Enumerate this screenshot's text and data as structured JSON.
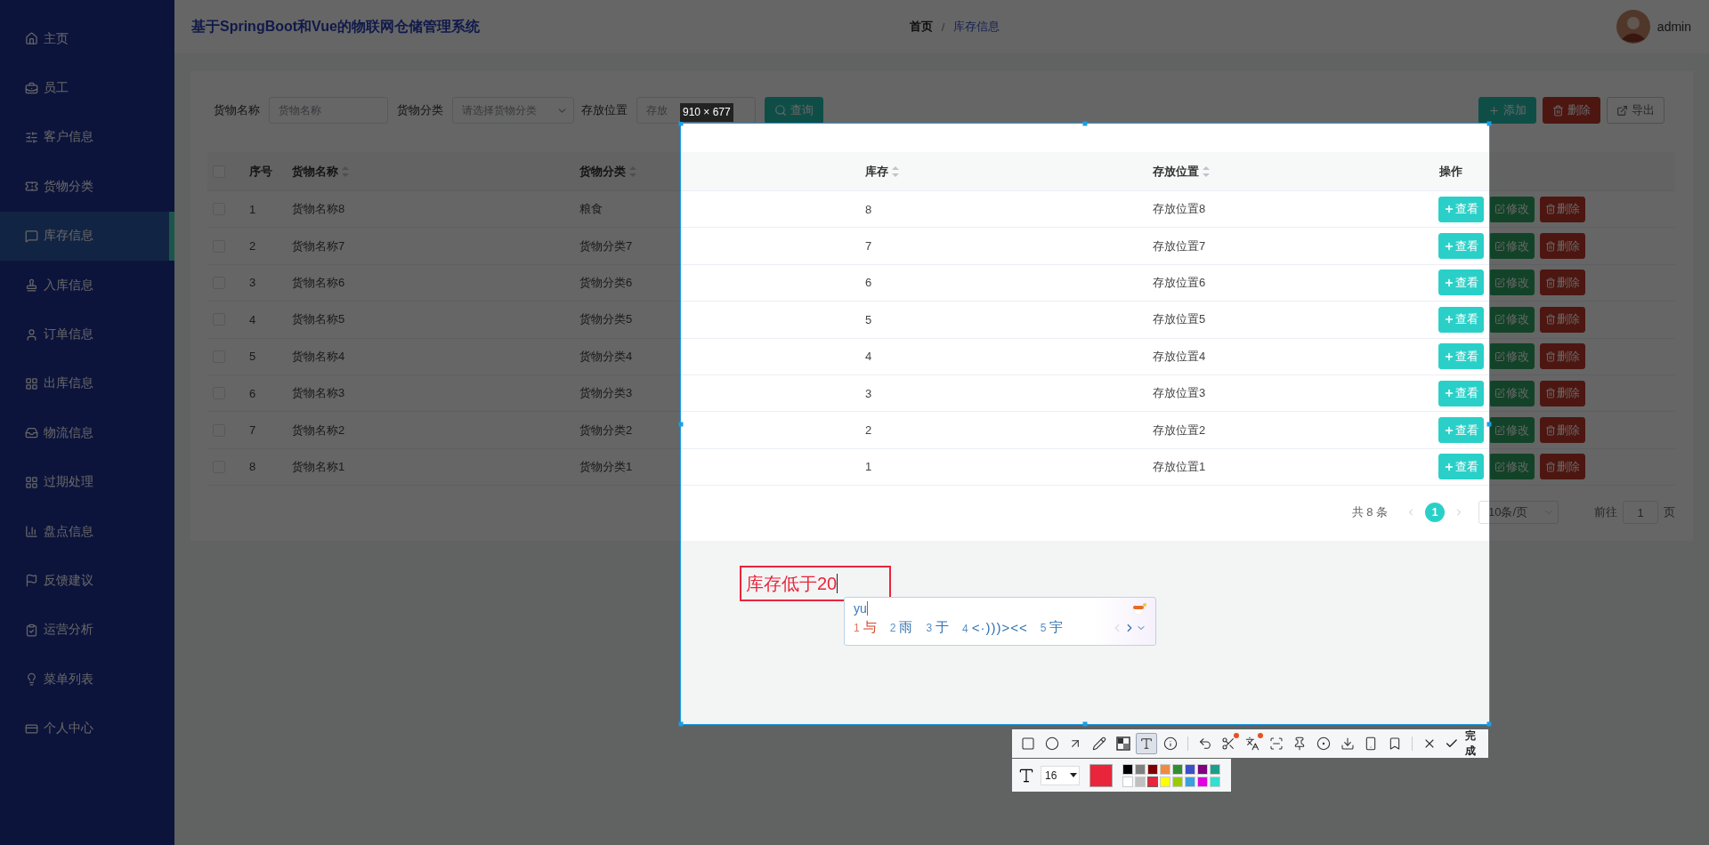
{
  "sidebar": {
    "items": [
      {
        "label": "主页",
        "selected": false
      },
      {
        "label": "员工",
        "selected": false
      },
      {
        "label": "客户信息",
        "selected": false
      },
      {
        "label": "货物分类",
        "selected": false
      },
      {
        "label": "库存信息",
        "selected": true
      },
      {
        "label": "入库信息",
        "selected": false
      },
      {
        "label": "订单信息",
        "selected": false
      },
      {
        "label": "出库信息",
        "selected": false
      },
      {
        "label": "物流信息",
        "selected": false
      },
      {
        "label": "过期处理",
        "selected": false
      },
      {
        "label": "盘点信息",
        "selected": false
      },
      {
        "label": "反馈建议",
        "selected": false
      },
      {
        "label": "运营分析",
        "selected": false
      },
      {
        "label": "菜单列表",
        "selected": false
      },
      {
        "label": "个人中心",
        "selected": false
      }
    ]
  },
  "header": {
    "title": "基于SpringBoot和Vue的物联网仓储管理系统",
    "breadcrumb": [
      {
        "label": "首页",
        "current": false
      },
      {
        "label": "库存信息",
        "current": true
      }
    ],
    "separator": "/",
    "user": "admin"
  },
  "filters": [
    {
      "label": "货物名称",
      "placeholder": "货物名称",
      "kind": "input"
    },
    {
      "label": "货物分类",
      "placeholder": "请选择货物分类",
      "kind": "select"
    },
    {
      "label": "存放位置",
      "placeholder": "存放",
      "kind": "input"
    }
  ],
  "search_button": "查询",
  "toolbar_buttons": [
    {
      "label": "添加",
      "kind": "add"
    },
    {
      "label": "删除",
      "kind": "delete"
    },
    {
      "label": "导出",
      "kind": "export"
    }
  ],
  "table": {
    "all_checked": false,
    "columns": [
      {
        "label": "序号",
        "sortable": false
      },
      {
        "label": "货物名称",
        "sortable": true
      },
      {
        "label": "货物分类",
        "sortable": true
      },
      {
        "label": "库存",
        "sortable": true
      },
      {
        "label": "存放位置",
        "sortable": true
      },
      {
        "label": "操作",
        "sortable": false
      }
    ],
    "rows": [
      {
        "checked": false,
        "cells": [
          "1",
          "货物名称8",
          "粮食",
          "8",
          "存放位置8"
        ],
        "actions": [
          {
            "label": "查看",
            "kind": "view"
          },
          {
            "label": "修改",
            "kind": "edit"
          },
          {
            "label": "删除",
            "kind": "delete"
          }
        ]
      },
      {
        "checked": false,
        "cells": [
          "2",
          "货物名称7",
          "货物分类7",
          "7",
          "存放位置7"
        ],
        "actions": [
          {
            "label": "查看",
            "kind": "view"
          },
          {
            "label": "修改",
            "kind": "edit"
          },
          {
            "label": "删除",
            "kind": "delete"
          }
        ]
      },
      {
        "checked": false,
        "cells": [
          "3",
          "货物名称6",
          "货物分类6",
          "6",
          "存放位置6"
        ],
        "actions": [
          {
            "label": "查看",
            "kind": "view"
          },
          {
            "label": "修改",
            "kind": "edit"
          },
          {
            "label": "删除",
            "kind": "delete"
          }
        ]
      },
      {
        "checked": false,
        "cells": [
          "4",
          "货物名称5",
          "货物分类5",
          "5",
          "存放位置5"
        ],
        "actions": [
          {
            "label": "查看",
            "kind": "view"
          },
          {
            "label": "修改",
            "kind": "edit"
          },
          {
            "label": "删除",
            "kind": "delete"
          }
        ]
      },
      {
        "checked": false,
        "cells": [
          "5",
          "货物名称4",
          "货物分类4",
          "4",
          "存放位置4"
        ],
        "actions": [
          {
            "label": "查看",
            "kind": "view"
          },
          {
            "label": "修改",
            "kind": "edit"
          },
          {
            "label": "删除",
            "kind": "delete"
          }
        ]
      },
      {
        "checked": false,
        "cells": [
          "6",
          "货物名称3",
          "货物分类3",
          "3",
          "存放位置3"
        ],
        "actions": [
          {
            "label": "查看",
            "kind": "view"
          },
          {
            "label": "修改",
            "kind": "edit"
          },
          {
            "label": "删除",
            "kind": "delete"
          }
        ]
      },
      {
        "checked": false,
        "cells": [
          "7",
          "货物名称2",
          "货物分类2",
          "2",
          "存放位置2"
        ],
        "actions": [
          {
            "label": "查看",
            "kind": "view"
          },
          {
            "label": "修改",
            "kind": "edit"
          },
          {
            "label": "删除",
            "kind": "delete"
          }
        ]
      },
      {
        "checked": false,
        "cells": [
          "8",
          "货物名称1",
          "货物分类1",
          "1",
          "存放位置1"
        ],
        "actions": [
          {
            "label": "查看",
            "kind": "view"
          },
          {
            "label": "修改",
            "kind": "edit"
          },
          {
            "label": "删除",
            "kind": "delete"
          }
        ]
      }
    ]
  },
  "pagination": {
    "total": "共 8 条",
    "pages": [
      {
        "label": "1",
        "selected": true
      }
    ],
    "page_size": "10条/页",
    "goto_prefix": "前往",
    "goto_value": "1",
    "goto_suffix": "页"
  },
  "capture": {
    "size_label": "910 × 677",
    "annotation": "库存低于20",
    "ime": {
      "input": "yu",
      "candidates": [
        {
          "index": "1",
          "text": "与",
          "selected": true
        },
        {
          "index": "2",
          "text": "雨",
          "selected": false
        },
        {
          "index": "3",
          "text": "于",
          "selected": false
        },
        {
          "index": "4",
          "text": "<·)))><<",
          "selected": false
        },
        {
          "index": "5",
          "text": "宇",
          "selected": false
        }
      ]
    },
    "tool_groups": [
      {
        "tools": [
          {
            "kind": "rectangle",
            "selected": false,
            "badge": false
          },
          {
            "kind": "ellipse",
            "selected": false,
            "badge": false
          },
          {
            "kind": "arrow",
            "selected": false,
            "badge": false
          },
          {
            "kind": "pencil",
            "selected": false,
            "badge": false
          },
          {
            "kind": "mosaic",
            "selected": false,
            "badge": false
          },
          {
            "kind": "text",
            "selected": true,
            "badge": false
          },
          {
            "kind": "number",
            "selected": false,
            "badge": false
          }
        ]
      },
      {
        "tools": [
          {
            "kind": "undo",
            "selected": false,
            "badge": false
          },
          {
            "kind": "cut",
            "selected": false,
            "badge": true
          },
          {
            "kind": "translate",
            "selected": false,
            "badge": true
          },
          {
            "kind": "scan",
            "selected": false,
            "badge": false
          },
          {
            "kind": "pin",
            "selected": false,
            "badge": false
          },
          {
            "kind": "record",
            "selected": false,
            "badge": false
          },
          {
            "kind": "download",
            "selected": false,
            "badge": false
          },
          {
            "kind": "phone",
            "selected": false,
            "badge": false
          },
          {
            "kind": "bookmark",
            "selected": false,
            "badge": false
          }
        ]
      },
      {
        "tools": [
          {
            "kind": "close",
            "selected": false,
            "badge": false
          }
        ]
      }
    ],
    "done_label": "完成",
    "font_size": "16",
    "palette": [
      {
        "color": "#000000",
        "selected": false
      },
      {
        "color": "#808080",
        "selected": false
      },
      {
        "color": "#800000",
        "selected": false
      },
      {
        "color": "#f08a3e",
        "selected": false
      },
      {
        "color": "#2f8f2f",
        "selected": false
      },
      {
        "color": "#3b50c8",
        "selected": false
      },
      {
        "color": "#800080",
        "selected": false
      },
      {
        "color": "#1aa08a",
        "selected": false
      },
      {
        "color": "#ffffff",
        "selected": false
      },
      {
        "color": "#c0c0c0",
        "selected": false
      },
      {
        "color": "#e8253a",
        "selected": true
      },
      {
        "color": "#ffff00",
        "selected": false
      },
      {
        "color": "#99cc00",
        "selected": false
      },
      {
        "color": "#3aa0e0",
        "selected": false
      },
      {
        "color": "#e000e0",
        "selected": false
      },
      {
        "color": "#30e0d0",
        "selected": false
      }
    ]
  }
}
